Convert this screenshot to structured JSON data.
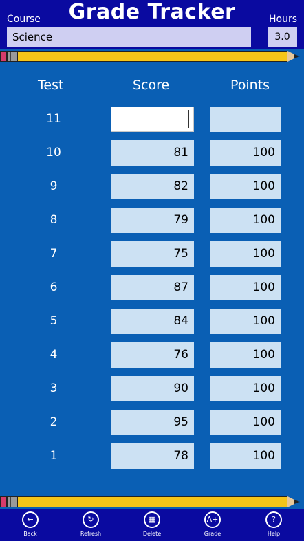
{
  "header": {
    "title": "Grade Tracker",
    "course_label": "Course",
    "course_value": "Science",
    "hours_label": "Hours",
    "hours_value": "3.0"
  },
  "table": {
    "columns": [
      "Test",
      "Score",
      "Points"
    ],
    "rows": [
      {
        "test": "11",
        "score": "",
        "points": ""
      },
      {
        "test": "10",
        "score": "81",
        "points": "100"
      },
      {
        "test": "9",
        "score": "82",
        "points": "100"
      },
      {
        "test": "8",
        "score": "79",
        "points": "100"
      },
      {
        "test": "7",
        "score": "75",
        "points": "100"
      },
      {
        "test": "6",
        "score": "87",
        "points": "100"
      },
      {
        "test": "5",
        "score": "84",
        "points": "100"
      },
      {
        "test": "4",
        "score": "76",
        "points": "100"
      },
      {
        "test": "3",
        "score": "90",
        "points": "100"
      },
      {
        "test": "2",
        "score": "95",
        "points": "100"
      },
      {
        "test": "1",
        "score": "78",
        "points": "100"
      }
    ]
  },
  "appbar": {
    "buttons": [
      {
        "label": "Back",
        "icon": "back-icon"
      },
      {
        "label": "Refresh",
        "icon": "refresh-icon"
      },
      {
        "label": "Delete",
        "icon": "delete-icon"
      },
      {
        "label": "Grade",
        "icon": "grade-icon"
      },
      {
        "label": "Help",
        "icon": "help-icon"
      }
    ]
  },
  "colors": {
    "background": "#0a5fb4",
    "header_band": "#0a0aa0",
    "field": "#cce1f3",
    "pencil_body": "#f5c518"
  }
}
